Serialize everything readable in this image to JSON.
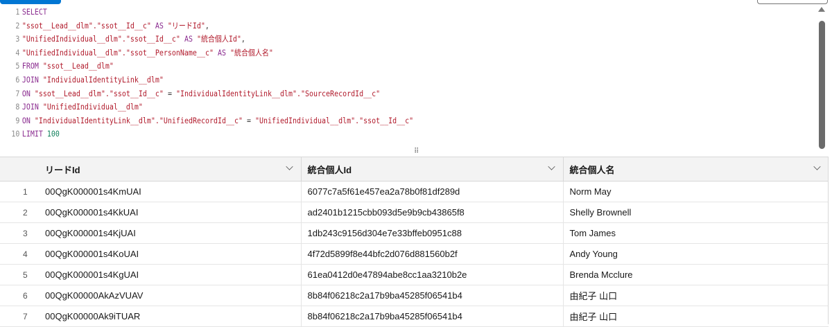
{
  "editor": {
    "lines": [
      {
        "n": "1",
        "tokens": [
          {
            "t": "SELECT",
            "c": "kw"
          }
        ]
      },
      {
        "n": "2",
        "tokens": [
          {
            "t": "\"ssot__Lead__dlm\".\"ssot__Id__c\"",
            "c": "str"
          },
          {
            "t": " AS ",
            "c": "kw"
          },
          {
            "t": "\"リードId\"",
            "c": "str"
          },
          {
            "t": ",",
            "c": "plain"
          }
        ]
      },
      {
        "n": "3",
        "tokens": [
          {
            "t": "\"UnifiedIndividual__dlm\".\"ssot__Id__c\"",
            "c": "str"
          },
          {
            "t": " AS ",
            "c": "kw"
          },
          {
            "t": "\"統合個人Id\"",
            "c": "str"
          },
          {
            "t": ",",
            "c": "plain"
          }
        ]
      },
      {
        "n": "4",
        "tokens": [
          {
            "t": "\"UnifiedIndividual__dlm\".\"ssot__PersonName__c\"",
            "c": "str"
          },
          {
            "t": " AS ",
            "c": "kw"
          },
          {
            "t": "\"統合個人名\"",
            "c": "str"
          }
        ]
      },
      {
        "n": "5",
        "tokens": [
          {
            "t": "FROM ",
            "c": "kw"
          },
          {
            "t": "\"ssot__Lead__dlm\"",
            "c": "str"
          }
        ]
      },
      {
        "n": "6",
        "tokens": [
          {
            "t": "JOIN ",
            "c": "kw"
          },
          {
            "t": "\"IndividualIdentityLink__dlm\"",
            "c": "str"
          }
        ]
      },
      {
        "n": "7",
        "tokens": [
          {
            "t": "ON ",
            "c": "kw"
          },
          {
            "t": "\"ssot__Lead__dlm\".\"ssot__Id__c\"",
            "c": "str"
          },
          {
            "t": " = ",
            "c": "plain"
          },
          {
            "t": "\"IndividualIdentityLink__dlm\".\"SourceRecordId__c\"",
            "c": "str"
          }
        ]
      },
      {
        "n": "8",
        "tokens": [
          {
            "t": "JOIN ",
            "c": "kw"
          },
          {
            "t": "\"UnifiedIndividual__dlm\"",
            "c": "str"
          }
        ]
      },
      {
        "n": "9",
        "tokens": [
          {
            "t": "ON ",
            "c": "kw"
          },
          {
            "t": "\"IndividualIdentityLink__dlm\".\"UnifiedRecordId__c\"",
            "c": "str"
          },
          {
            "t": " = ",
            "c": "plain"
          },
          {
            "t": "\"UnifiedIndividual__dlm\".\"ssot__Id__c\"",
            "c": "str"
          }
        ]
      },
      {
        "n": "10",
        "tokens": [
          {
            "t": "LIMIT ",
            "c": "kw"
          },
          {
            "t": "100",
            "c": "num"
          }
        ]
      }
    ]
  },
  "grid": {
    "columns": [
      {
        "label": "リードId"
      },
      {
        "label": "統合個人Id"
      },
      {
        "label": "統合個人名"
      }
    ],
    "rows": [
      {
        "n": "1",
        "lead": "00QgK000001s4KmUAI",
        "uid": "6077c7a5f61e457ea2a78b0f81df289d",
        "name": "Norm May"
      },
      {
        "n": "2",
        "lead": "00QgK000001s4KkUAI",
        "uid": "ad2401b1215cbb093d5e9b9cb43865f8",
        "name": "Shelly Brownell"
      },
      {
        "n": "3",
        "lead": "00QgK000001s4KjUAI",
        "uid": "1db243c9156d304e7e33bffeb0951c88",
        "name": "Tom James"
      },
      {
        "n": "4",
        "lead": "00QgK000001s4KoUAI",
        "uid": "4f72d5899f8e44bfc2d076d881560b2f",
        "name": "Andy Young"
      },
      {
        "n": "5",
        "lead": "00QgK000001s4KgUAI",
        "uid": "61ea0412d0e47894abe8cc1aa3210b2e",
        "name": "Brenda Mcclure"
      },
      {
        "n": "6",
        "lead": "00QgK00000AkAzVUAV",
        "uid": "8b84f06218c2a17b9ba45285f06541b4",
        "name": "由紀子 山口"
      },
      {
        "n": "7",
        "lead": "00QgK00000Ak9iTUAR",
        "uid": "8b84f06218c2a17b9ba45285f06541b4",
        "name": "由紀子 山口"
      }
    ]
  }
}
